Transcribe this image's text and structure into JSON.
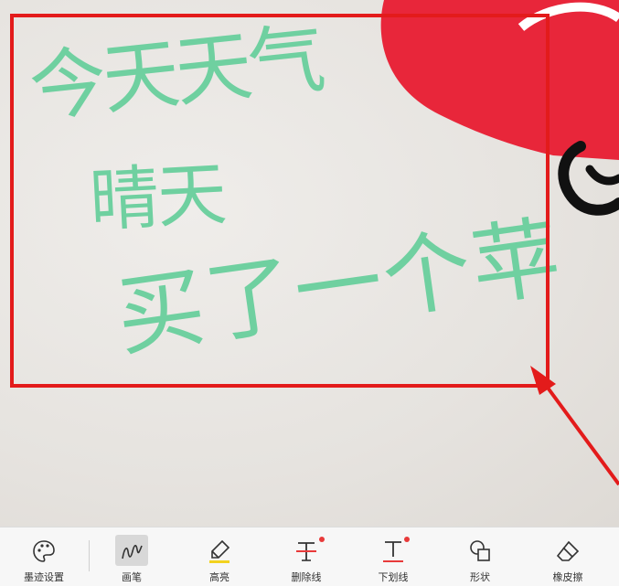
{
  "handwriting": {
    "line1": "今天天气",
    "line2": "晴天",
    "line3": "买了一个苹"
  },
  "colors": {
    "ink": "#6fd0a0",
    "selection": "#e31b1b",
    "heart": "#e8263a",
    "toolbar_bg": "#f7f7f7",
    "highlight_bar": "#f2d21f",
    "badge": "#e83a3a"
  },
  "toolbar": {
    "items": [
      {
        "label": "墨迹设置",
        "icon": "palette-icon"
      },
      {
        "label": "画笔",
        "icon": "pen-scribble-icon",
        "active": true
      },
      {
        "label": "高亮",
        "icon": "highlighter-icon"
      },
      {
        "label": "删除线",
        "icon": "strikethrough-icon",
        "badge": true
      },
      {
        "label": "下划线",
        "icon": "underline-icon",
        "badge": true
      },
      {
        "label": "形状",
        "icon": "shapes-icon"
      },
      {
        "label": "橡皮擦",
        "icon": "eraser-icon"
      }
    ]
  }
}
